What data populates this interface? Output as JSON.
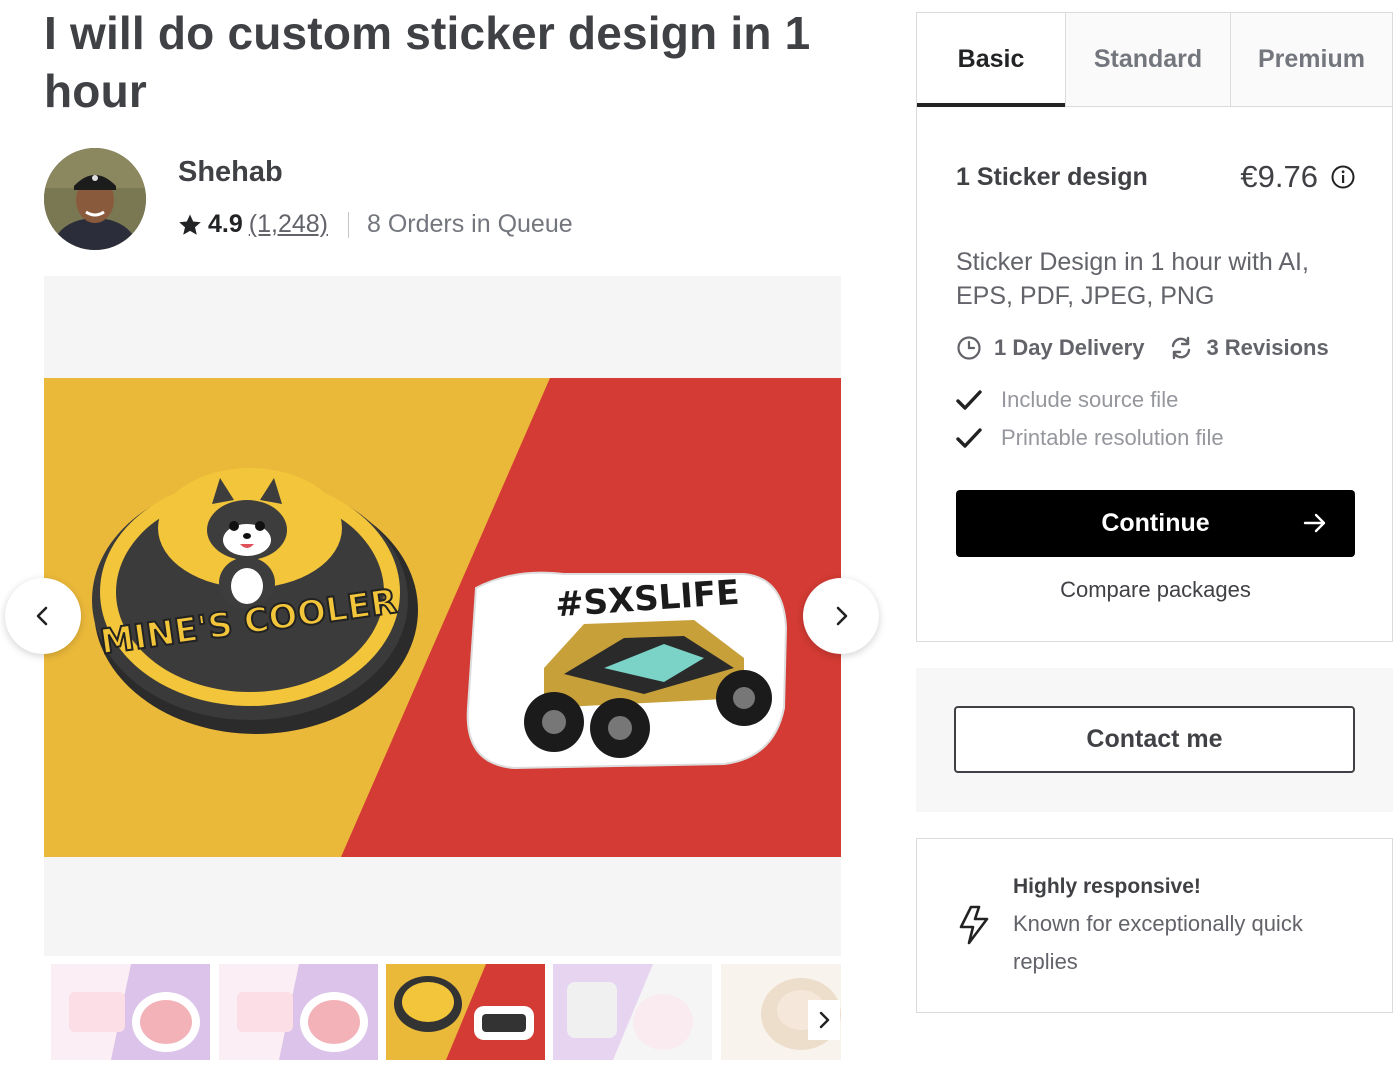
{
  "gig": {
    "title": "I will do custom sticker design in 1 hour"
  },
  "seller": {
    "name": "Shehab",
    "rating": "4.9",
    "reviews": "(1,248)",
    "queue": "8 Orders in Queue"
  },
  "gallery": {
    "slide_texts": [
      "MINE'S COOLER",
      "#SXSLIFE"
    ],
    "thumbnail_count": 5,
    "active_thumbnail": 3
  },
  "package": {
    "tabs": [
      {
        "label": "Basic",
        "active": true
      },
      {
        "label": "Standard",
        "active": false
      },
      {
        "label": "Premium",
        "active": false
      }
    ],
    "name": "1 Sticker design",
    "price": "€9.76",
    "description": "Sticker Design in 1 hour with AI, EPS, PDF, JPEG, PNG",
    "delivery": "1 Day Delivery",
    "revisions": "3 Revisions",
    "features": [
      "Include source file",
      "Printable resolution file"
    ],
    "continue_label": "Continue",
    "compare_label": "Compare packages"
  },
  "contact": {
    "label": "Contact me"
  },
  "responsive": {
    "title": "Highly responsive!",
    "text": "Known for exceptionally quick replies"
  },
  "colors": {
    "slide_yellow": "#EBB93A",
    "slide_red": "#D33B34",
    "button_dark": "#000000",
    "text_dark": "#404145"
  },
  "icons": [
    "star-icon",
    "info-icon",
    "clock-icon",
    "refresh-icon",
    "check-icon",
    "arrow-right-icon",
    "chevron-left-icon",
    "chevron-right-icon",
    "lightning-icon"
  ]
}
